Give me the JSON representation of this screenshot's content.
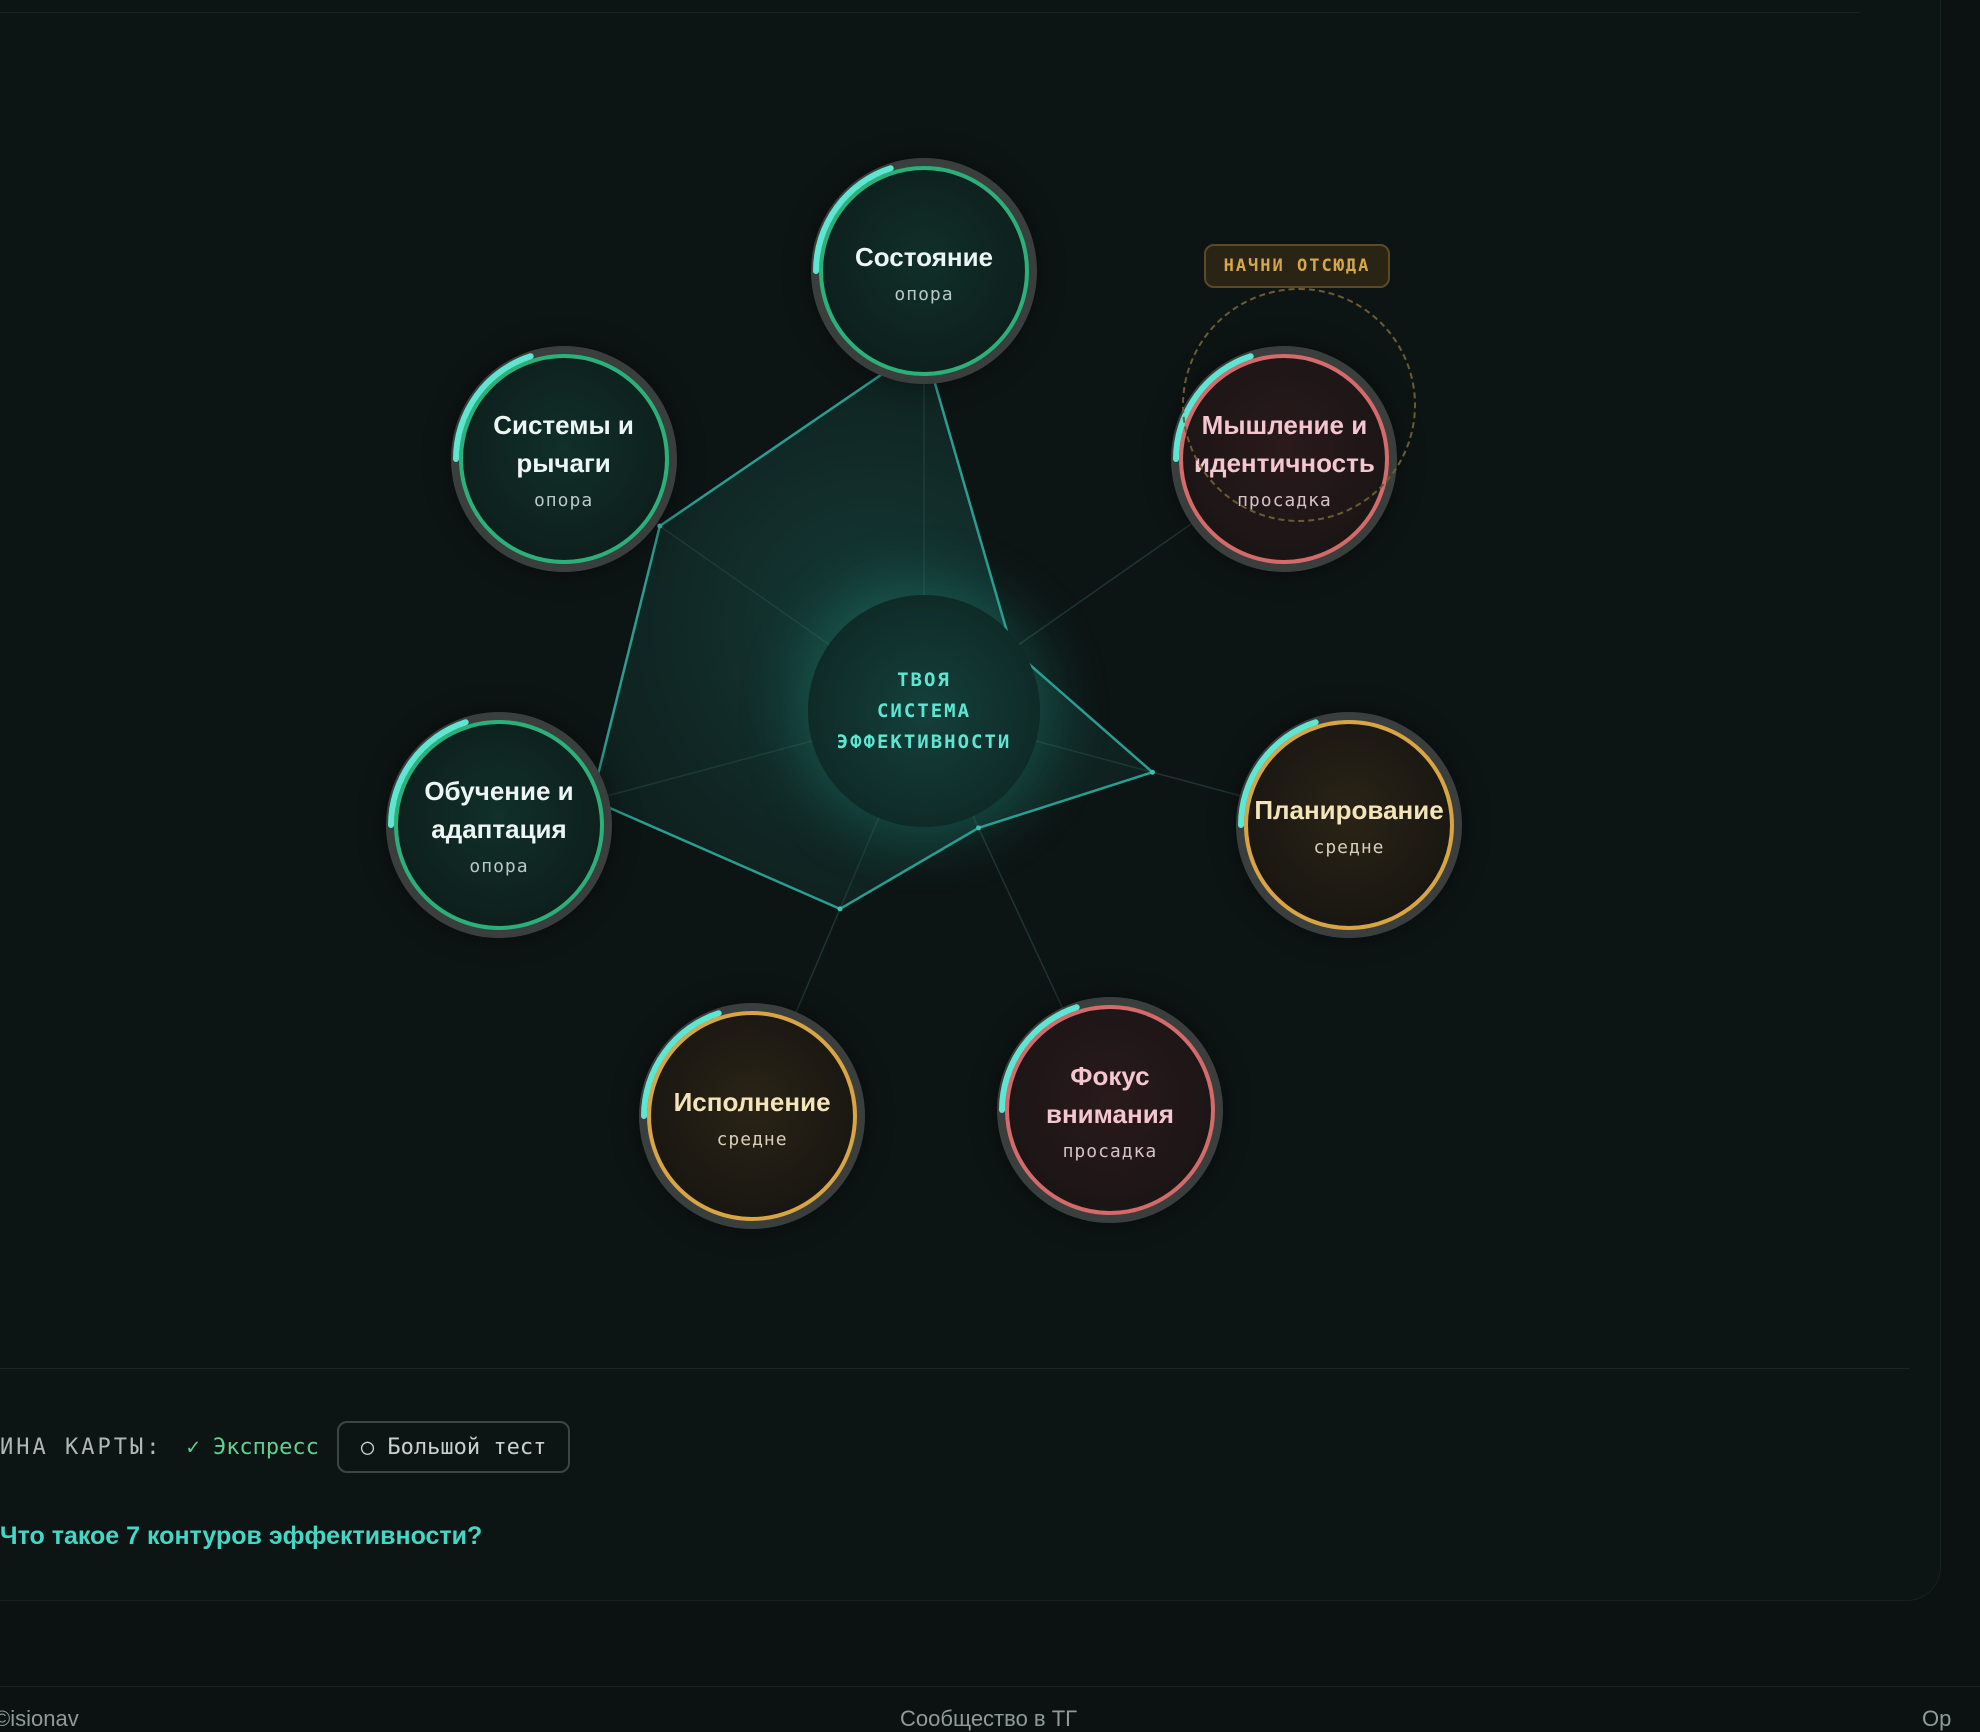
{
  "center": {
    "line1": "ТВОЯ",
    "line2": "СИСТЕМА",
    "line3": "ЭФФЕКТИВНОСТИ"
  },
  "start_badge": "НАЧНИ ОТСЮДА",
  "nodes": [
    {
      "id": "state",
      "title": "Состояние",
      "status": "опора",
      "level": "green",
      "score": 0.85
    },
    {
      "id": "mindset",
      "title": "Мышление и идентичность",
      "status": "просадка",
      "level": "red",
      "score": 0.25
    },
    {
      "id": "planning",
      "title": "Планирование",
      "status": "средне",
      "level": "amber",
      "score": 0.55
    },
    {
      "id": "focus",
      "title": "Фокус внимания",
      "status": "просадка",
      "level": "red",
      "score": 0.3
    },
    {
      "id": "execution",
      "title": "Исполнение",
      "status": "средне",
      "level": "amber",
      "score": 0.5
    },
    {
      "id": "learning",
      "title": "Обучение и адаптация",
      "status": "опора",
      "level": "green",
      "score": 0.8
    },
    {
      "id": "systems",
      "title": "Системы и рычаги",
      "status": "опора",
      "level": "green",
      "score": 0.75
    }
  ],
  "depth": {
    "label": "ИНА КАРТЫ:",
    "active": "✓ Экспресс",
    "other": "○ Большой тест"
  },
  "faq": "Что такое 7 контуров эффективности?",
  "footer": {
    "left": "©isionav",
    "mid": "Сообщество в ТГ",
    "right": "Ор"
  },
  "colors": {
    "accent": "#5ee6d3",
    "green": "#2bb07a",
    "amber": "#d9a444",
    "red": "#d46a6a"
  }
}
